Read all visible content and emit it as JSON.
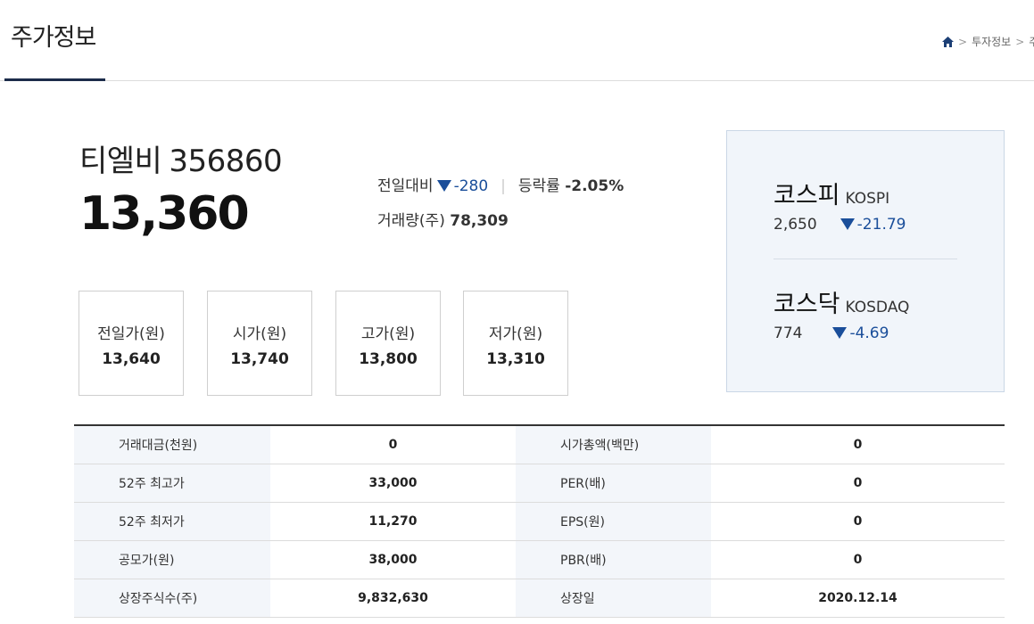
{
  "header": {
    "title": "주가정보",
    "breadcrumb": [
      "투자정보",
      "주"
    ]
  },
  "stock": {
    "name": "티엘비",
    "code": "356860",
    "price": "13,360",
    "change_label": "전일대비",
    "change_value": "-280",
    "rate_label": "등락률",
    "rate_value": "-2.05%",
    "volume_label": "거래량(주)",
    "volume_value": "78,309",
    "direction": "down"
  },
  "price_boxes": [
    {
      "label": "전일가(원)",
      "value": "13,640"
    },
    {
      "label": "시가(원)",
      "value": "13,740"
    },
    {
      "label": "고가(원)",
      "value": "13,800"
    },
    {
      "label": "저가(원)",
      "value": "13,310"
    }
  ],
  "indices": {
    "kospi": {
      "name": "코스피",
      "eng": "KOSPI",
      "value": "2,650",
      "change": "-21.79"
    },
    "kosdaq": {
      "name": "코스닥",
      "eng": "KOSDAQ",
      "value": "774",
      "change": "-4.69"
    }
  },
  "table": [
    {
      "l1": "거래대금(천원)",
      "v1": "0",
      "l2": "시가총액(백만)",
      "v2": "0"
    },
    {
      "l1": "52주 최고가",
      "v1": "33,000",
      "l2": "PER(배)",
      "v2": "0"
    },
    {
      "l1": "52주 최저가",
      "v1": "11,270",
      "l2": "EPS(원)",
      "v2": "0"
    },
    {
      "l1": "공모가(원)",
      "v1": "38,000",
      "l2": "PBR(배)",
      "v2": "0"
    },
    {
      "l1": "상장주식수(주)",
      "v1": "9,832,630",
      "l2": "상장일",
      "v2": "2020.12.14"
    }
  ],
  "colors": {
    "down": "#1a4e9a",
    "panel_bg": "#f1f5fa",
    "title_underline": "#1c2c4a"
  }
}
